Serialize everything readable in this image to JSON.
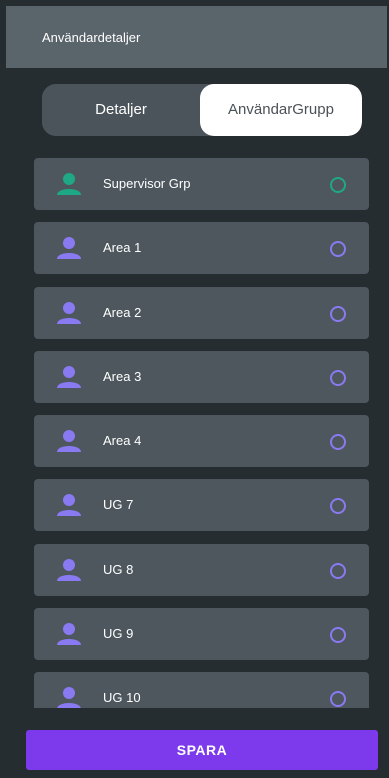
{
  "header": {
    "title": "Användardetaljer"
  },
  "tabs": [
    {
      "label": "Detaljer",
      "selected": false
    },
    {
      "label": "AnvändarGrupp",
      "selected": true
    }
  ],
  "groups": [
    {
      "label": "Supervisor Grp",
      "icon": "user-icon",
      "icon_color": "#1fa885",
      "radio_color": "#1fa885",
      "selected": false
    },
    {
      "label": "Area 1",
      "icon": "user-icon",
      "icon_color": "#8a7af2",
      "radio_color": "#8a7af2",
      "selected": false
    },
    {
      "label": "Area 2",
      "icon": "user-icon",
      "icon_color": "#8a7af2",
      "radio_color": "#8a7af2",
      "selected": false
    },
    {
      "label": "Area 3",
      "icon": "user-icon",
      "icon_color": "#8a7af2",
      "radio_color": "#8a7af2",
      "selected": false
    },
    {
      "label": "Area 4",
      "icon": "user-icon",
      "icon_color": "#8a7af2",
      "radio_color": "#8a7af2",
      "selected": false
    },
    {
      "label": "UG 7",
      "icon": "user-icon",
      "icon_color": "#8a7af2",
      "radio_color": "#8a7af2",
      "selected": false
    },
    {
      "label": "UG 8",
      "icon": "user-icon",
      "icon_color": "#8a7af2",
      "radio_color": "#8a7af2",
      "selected": false
    },
    {
      "label": "UG 9",
      "icon": "user-icon",
      "icon_color": "#8a7af2",
      "radio_color": "#8a7af2",
      "selected": false
    },
    {
      "label": "UG 10",
      "icon": "user-icon",
      "icon_color": "#8a7af2",
      "radio_color": "#8a7af2",
      "selected": false
    }
  ],
  "footer": {
    "save_label": "SPARA"
  },
  "colors": {
    "background": "#262d31",
    "header": "#5a646b",
    "list_item": "#4d575d",
    "accent": "#7c3aec"
  }
}
